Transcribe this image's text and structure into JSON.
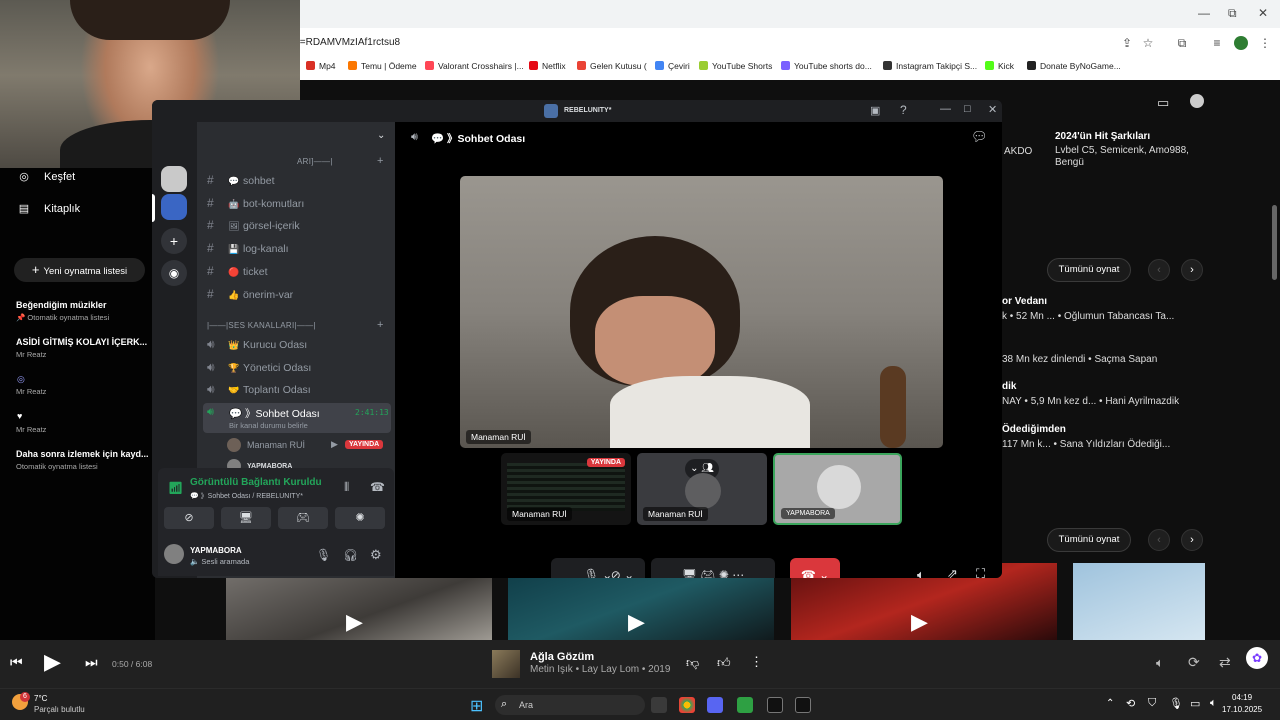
{
  "browser": {
    "url_fragment": "t=RDAMVMzIAf1rctsu8",
    "window_controls": [
      "—",
      "⧉",
      "✕"
    ],
    "bookmarks": [
      {
        "label": "Mp4",
        "color": "#d93025"
      },
      {
        "label": "Temu | Ödeme",
        "color": "#fb7701"
      },
      {
        "label": "Valorant Crosshairs |...",
        "color": "#ff4655"
      },
      {
        "label": "Netflix",
        "color": "#e50914"
      },
      {
        "label": "Gelen Kutusu (",
        "color": "#ea4335"
      },
      {
        "label": "Çeviri",
        "color": "#4285f4"
      },
      {
        "label": "YouTube Shorts",
        "color": "#9acd32"
      },
      {
        "label": "YouTube shorts do...",
        "color": "#7b61ff"
      },
      {
        "label": "Instagram Takipçi S...",
        "color": "#333333"
      },
      {
        "label": "Kick",
        "color": "#53fc18"
      },
      {
        "label": "Donate ByNoGame...",
        "color": "#222222"
      }
    ]
  },
  "ytm": {
    "nav": [
      {
        "icon": "compass-icon",
        "glyph": "◎",
        "label": "Keşfet"
      },
      {
        "icon": "library-icon",
        "glyph": "▤",
        "label": "Kitaplık"
      }
    ],
    "new_playlist": "Yeni oynatma listesi",
    "playlists": [
      {
        "title": "Beğendiğim müzikler",
        "sub": "📌 Otomatik oynatma listesi"
      },
      {
        "title": "ASİDİ GİTMİŞ KOLAYI İÇERK...",
        "sub": "Mr Reatz"
      },
      {
        "title": "",
        "sub": "Mr Reatz"
      },
      {
        "title": "",
        "sub": "Mr Reatz"
      },
      {
        "title": "Daha sonra izlemek için kayd...",
        "sub": "Otomatik oynatma listesi"
      }
    ],
    "right": {
      "akdo": "AKDO",
      "hit_title": "2024'ün Hit Şarkıları",
      "hit_artists_1": "Lvbel C5, Semicenk, Amo988,",
      "hit_artists_2": "Bengü",
      "see_all": "Tümünü oynat",
      "row1_title": "or Vedanı",
      "row1_sub": "k • 52 Mn ...  • Oğlumun Tabancası Ta...",
      "row2_sub": "38 Mn kez dinlendi • Saçma Sapan",
      "row3_title": "dik",
      "row3_sub": "NAY • 5,9 Mn kez d...  • Hani Ayrilmazdik",
      "row4_title": "Ödediğimden",
      "row4_sub": "117 Mn k...  • Sana Yıldızları Ödediği...",
      "see_all_2": "Tümünü oynat"
    }
  },
  "player": {
    "time": "0:50 / 6:08",
    "progress": 0.136,
    "song": "Ağla Gözüm",
    "meta": "Metin Işık • Lay Lay Lom • 2019"
  },
  "taskbar": {
    "temp": "7°C",
    "weather": "Parçalı bulutlu",
    "weather_badge": "6",
    "search": "Ara",
    "time": "04:19",
    "date": "17.10.2025"
  },
  "discord": {
    "title": "REBELUNITY*",
    "categories": {
      "text": "ARI]——|",
      "voice": "|——|SES KANALLARI|——|"
    },
    "text_channels": [
      {
        "emoji": "💬",
        "name": "sohbet"
      },
      {
        "emoji": "🤖",
        "name": "bot-komutları"
      },
      {
        "emoji": "🖼",
        "name": "görsel-içerik"
      },
      {
        "emoji": "💾",
        "name": "log-kanalı"
      },
      {
        "emoji": "🔴",
        "name": "ticket"
      },
      {
        "emoji": "👍",
        "name": "önerim-var"
      }
    ],
    "voice_channels": [
      {
        "emoji": "👑",
        "name": "Kurucu Odası"
      },
      {
        "emoji": "🏆",
        "name": "Yönetici Odası"
      },
      {
        "emoji": "🤝",
        "name": "Toplantı Odası"
      }
    ],
    "active_channel": {
      "name": "Sohbet Odası",
      "timer": "2:41:13",
      "status": "Bir kanal durumu belirle"
    },
    "members": [
      {
        "name": "Manaman RUİ",
        "live": "YAYINDA"
      },
      {
        "name": "YAPMABORA",
        "live": ""
      }
    ],
    "voice_panel": {
      "status": "Görüntülü Bağlantı Kuruldu",
      "channel": "💬 》Sohbet Odası / REBELUNITY*"
    },
    "user": {
      "name": "YAPMABORA",
      "status": "🔈 Sesli aramada"
    },
    "header_channel": "💬 》Sohbet Odası",
    "main_video_name": "Manaman RUİ",
    "tiles": [
      {
        "name": "Manaman RUİ",
        "live": "YAYINDA"
      },
      {
        "name": "Manaman RUİ",
        "live": ""
      },
      {
        "name": "YAPMABORA",
        "live": ""
      }
    ]
  }
}
